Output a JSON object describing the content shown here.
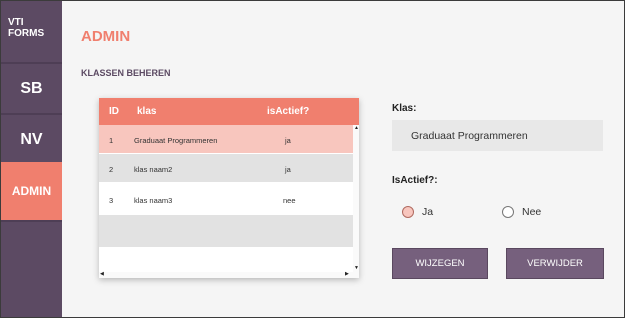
{
  "app": {
    "logo_line1": "VTI",
    "logo_line2": "FORMS"
  },
  "sidebar": {
    "items": [
      {
        "label": "SB"
      },
      {
        "label": "NV"
      },
      {
        "label": "ADMIN",
        "active": true
      }
    ]
  },
  "page": {
    "title": "ADMIN",
    "section": "KLASSEN BEHEREN"
  },
  "table": {
    "columns": [
      "ID",
      "klas",
      "isActief?"
    ],
    "rows": [
      {
        "id": "1",
        "klas": "Graduaat Programmeren",
        "actief": "ja",
        "selected": true
      },
      {
        "id": "2",
        "klas": "klas naam2",
        "actief": "ja"
      },
      {
        "id": "3",
        "klas": "klas naam3",
        "actief": "nee"
      }
    ]
  },
  "form": {
    "klas_label": "Klas:",
    "klas_value": "Graduaat Programmeren",
    "actief_label": "IsActief?:",
    "options": [
      {
        "label": "Ja",
        "selected": true
      },
      {
        "label": "Nee",
        "selected": false
      }
    ]
  },
  "buttons": {
    "edit": "WIJZEGEN",
    "delete": "VERWIJDER"
  },
  "colors": {
    "accent": "#f07f6e",
    "sidebar": "#5c4a63",
    "button": "#76607d",
    "selected_row": "#f8c6be"
  }
}
